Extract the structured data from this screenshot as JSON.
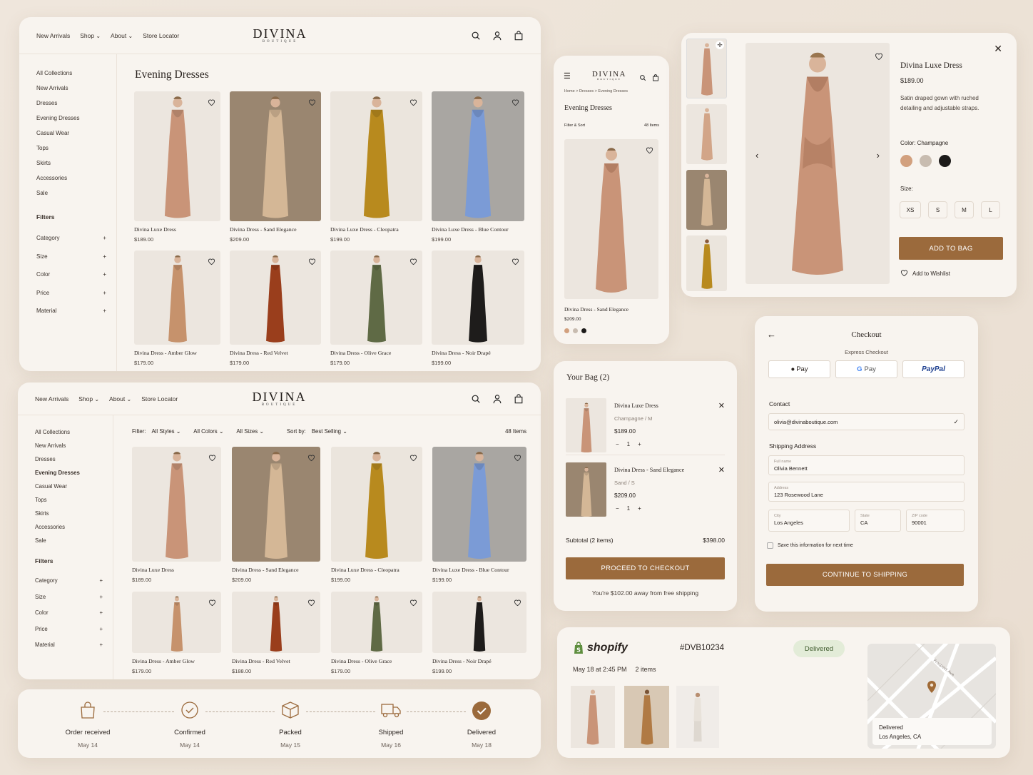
{
  "brand": {
    "logo_word": "DIVINA",
    "logo_sub": "BOUTIQUE"
  },
  "nav": {
    "new_arrivals": "New Arrivals",
    "shop": "Shop",
    "about": "About",
    "store_locator": "Store Locator"
  },
  "sidebar": {
    "items": [
      "All Collections",
      "New Arrivals",
      "Dresses",
      "Evening Dresses",
      "Casual Wear",
      "Tops",
      "Skirts",
      "Accessories",
      "Sale"
    ],
    "filters_title": "Filters",
    "filters": [
      "Category",
      "Size",
      "Color",
      "Price",
      "Material"
    ],
    "plus": "+"
  },
  "catalog": {
    "title": "Evening Dresses",
    "products": [
      {
        "name": "Divina Luxe Dress",
        "price": "$189.00",
        "color": "#c99478",
        "bg": "#ece6df"
      },
      {
        "name": "Divina Dress - Sand Elegance",
        "price": "$209.00",
        "color": "#d4b796",
        "bg": "#9a8670"
      },
      {
        "name": "Divina Luxe Dress - Cleopatra",
        "price": "$199.00",
        "color": "#b88a1e",
        "bg": "#ebe5dd"
      },
      {
        "name": "Divina Luxe Dress - Blue Contour",
        "price": "$199.00",
        "color": "#7b9bd6",
        "bg": "#a9a6a2"
      },
      {
        "name": "Divina Dress - Amber Glow",
        "price": "$179.00",
        "color": "#c6926c",
        "bg": "#ece6df"
      },
      {
        "name": "Divina Dress - Red Velvet",
        "price": "$179.00",
        "color": "#9a3e1c",
        "bg": "#ece6df"
      },
      {
        "name": "Divina Dress - Olive Grace",
        "price": "$179.00",
        "color": "#5f6a45",
        "bg": "#ece6df"
      },
      {
        "name": "Divina Dress - Noir Drapé",
        "price": "$199.00",
        "color": "#1e1c1b",
        "bg": "#ece6df"
      }
    ],
    "products_b": [
      {
        "name": "Divina Luxe Dress",
        "price": "$189.00"
      },
      {
        "name": "Divina Dress - Sand Elegance",
        "price": "$209.00"
      },
      {
        "name": "Divina Luxe Dress - Cleopatra",
        "price": "$199.00"
      },
      {
        "name": "Divina Luxe Dress - Blue Contour",
        "price": "$199.00"
      },
      {
        "name": "Divina Dress - Amber Glow",
        "price": "$179.00"
      },
      {
        "name": "Divina Dress - Red Velvet",
        "price": "$188.00"
      },
      {
        "name": "Divina Dress - Olive Grace",
        "price": "$179.00"
      },
      {
        "name": "Divina Dress - Noir Drapé",
        "price": "$199.00"
      }
    ]
  },
  "filterbar": {
    "filter": "Filter:",
    "styles": "All Styles",
    "colors": "All Colors",
    "sizes": "All Sizes",
    "sort_label": "Sort by:",
    "sort_value": "Best Selling",
    "count": "48 Items"
  },
  "mobile": {
    "crumb_home": "Home",
    "crumb_dresses": "Dresses",
    "crumb_evening": "Evening Dresses",
    "title": "Evening Dresses",
    "filter_sort": "Filter & Sort",
    "count": "48 Items",
    "product_name": "Divina Dress - Sand Elegance",
    "product_price": "$209.00"
  },
  "pdp": {
    "name": "Divina Luxe Dress",
    "price": "$189.00",
    "desc": "Satin draped gown with ruched detailing and adjustable straps.",
    "color_label": "Color:",
    "color_value": "Champagne",
    "swatches": [
      "#d2a07e",
      "#c8bcb0",
      "#1c1a19"
    ],
    "size_label": "Size:",
    "sizes": [
      "XS",
      "S",
      "M",
      "L"
    ],
    "add_to_bag": "ADD TO BAG",
    "wishlist": "Add to Wishlist"
  },
  "bag": {
    "title": "Your Bag (2)",
    "items": [
      {
        "name": "Divina Luxe Dress",
        "variant": "Champagne / M",
        "price": "$189.00",
        "qty": "1"
      },
      {
        "name": "Divina Dress - Sand Elegance",
        "variant": "Sand / S",
        "price": "$209.00",
        "qty": "1"
      }
    ],
    "minus": "−",
    "plus": "+",
    "subtotal_label": "Subtotal (2 items)",
    "subtotal": "$398.00",
    "checkout": "PROCEED TO CHECKOUT",
    "free_ship": "You're $102.00 away from free shipping"
  },
  "checkout": {
    "title": "Checkout",
    "express": "Express Checkout",
    "apple": "Pay",
    "google_g": "G",
    "google": "Pay",
    "paypal": "PayPal",
    "contact": "Contact",
    "email": "olivia@divinaboutique.com",
    "shipping": "Shipping Address",
    "fullname_label": "Full name",
    "fullname": "Olivia Bennett",
    "address_label": "Address",
    "address": "123 Rosewood Lane",
    "city_label": "City",
    "city": "Los Angeles",
    "state_label": "State",
    "state": "CA",
    "zip_label": "ZIP code",
    "zip": "90001",
    "save": "Save this information for next time",
    "continue": "CONTINUE TO SHIPPING"
  },
  "order": {
    "shopify": "shopify",
    "number": "#DVB10234",
    "status": "Delivered",
    "date": "May 18 at 2:45 PM",
    "items": "2 items",
    "map_status": "Delivered",
    "map_city": "Los Angeles, CA",
    "street": "Prospect Ave"
  },
  "tracker": {
    "steps": [
      {
        "label": "Order received",
        "date": "May 14"
      },
      {
        "label": "Confirmed",
        "date": "May 14"
      },
      {
        "label": "Packed",
        "date": "May 15"
      },
      {
        "label": "Shipped",
        "date": "May 16"
      },
      {
        "label": "Delivered",
        "date": "May 18"
      }
    ]
  },
  "colors": {
    "accent": "#9b6a3c",
    "bg": "#f8f4ef"
  }
}
